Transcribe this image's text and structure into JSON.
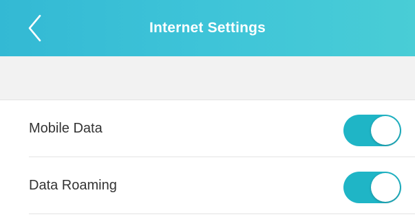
{
  "header": {
    "title": "Internet Settings",
    "back_icon": "chevron-left-icon",
    "gradient_start": "#33b9d4",
    "gradient_end": "#49cdd6"
  },
  "settings": [
    {
      "label": "Mobile Data",
      "enabled": true
    },
    {
      "label": "Data Roaming",
      "enabled": true
    }
  ],
  "colors": {
    "toggle_on": "#1fb5c6",
    "background_section": "#f2f2f2",
    "text": "#333333"
  }
}
